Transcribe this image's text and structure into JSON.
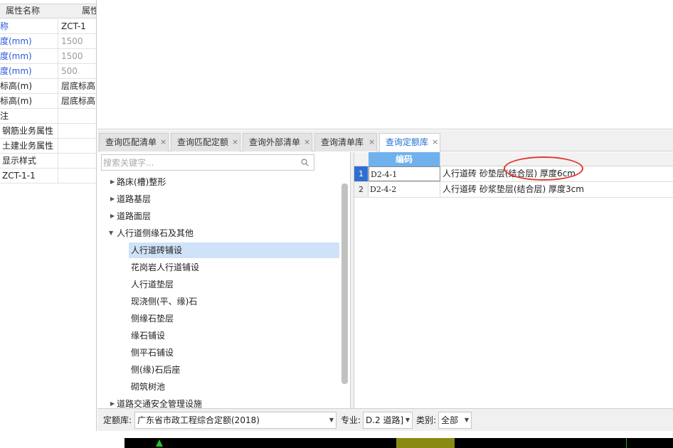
{
  "property_panel": {
    "header": {
      "name_col": "属性名称",
      "value_col": "属性"
    },
    "rows": [
      {
        "name": "称",
        "value": "ZCT-1"
      },
      {
        "name": "度(mm)",
        "value": "1500"
      },
      {
        "name": "度(mm)",
        "value": "1500"
      },
      {
        "name": "度(mm)",
        "value": "500"
      },
      {
        "name": "标高(m)",
        "value": "层底标高"
      },
      {
        "name": "标高(m)",
        "value": "层底标高"
      },
      {
        "name": "注",
        "value": ""
      },
      {
        "name": "钢筋业务属性",
        "value": ""
      },
      {
        "name": "土建业务属性",
        "value": ""
      },
      {
        "name": "显示样式",
        "value": ""
      },
      {
        "name": "ZCT-1-1",
        "value": ""
      }
    ]
  },
  "tabs": [
    {
      "label": "查询匹配清单",
      "close": "×"
    },
    {
      "label": "查询匹配定额",
      "close": "×"
    },
    {
      "label": "查询外部清单",
      "close": "×"
    },
    {
      "label": "查询清单库",
      "close": "×"
    },
    {
      "label": "查询定额库",
      "close": "×",
      "active": true
    }
  ],
  "search": {
    "placeholder": "搜索关键字..."
  },
  "tree": {
    "items": [
      {
        "label": "路床(槽)整形",
        "caret": "▶",
        "level": 0
      },
      {
        "label": "道路基层",
        "caret": "▶",
        "level": 0
      },
      {
        "label": "道路面层",
        "caret": "▶",
        "level": 0
      },
      {
        "label": "人行道侧缘石及其他",
        "caret": "▼",
        "level": 0
      },
      {
        "label": "人行道砖铺设",
        "caret": "",
        "level": 1,
        "selected": true
      },
      {
        "label": "花岗岩人行道铺设",
        "caret": "",
        "level": 1
      },
      {
        "label": "人行道垫层",
        "caret": "",
        "level": 1
      },
      {
        "label": "现浇侧(平、缘)石",
        "caret": "",
        "level": 1
      },
      {
        "label": "侧缘石垫层",
        "caret": "",
        "level": 1
      },
      {
        "label": "缘石铺设",
        "caret": "",
        "level": 1
      },
      {
        "label": "侧平石铺设",
        "caret": "",
        "level": 1
      },
      {
        "label": "侧(缘)石后座",
        "caret": "",
        "level": 1
      },
      {
        "label": "砌筑树池",
        "caret": "",
        "level": 1
      },
      {
        "label": "道路交通安全管理设施",
        "caret": "▶",
        "level": 0
      }
    ]
  },
  "grid": {
    "header": {
      "code": "编码"
    },
    "rows": [
      {
        "num": "1",
        "code": "D2-4-1",
        "name": "人行道砖 砂垫层(结合层) 厚度6cm"
      },
      {
        "num": "2",
        "code": "D2-4-2",
        "name": "人行道砖 砂浆垫层(结合层) 厚度3cm"
      }
    ]
  },
  "bottom_bar": {
    "quota_label": "定额库:",
    "quota_value": "广东省市政工程综合定额(2018)",
    "specialty_label": "专业:",
    "specialty_value": "D.2 道路]",
    "category_label": "类别:",
    "category_value": "全部"
  },
  "colors": {
    "accent": "#1f6fd1",
    "header_cell": "#6fb1ec",
    "selection": "#cfe2f7",
    "annotation": "#e23a2e"
  }
}
